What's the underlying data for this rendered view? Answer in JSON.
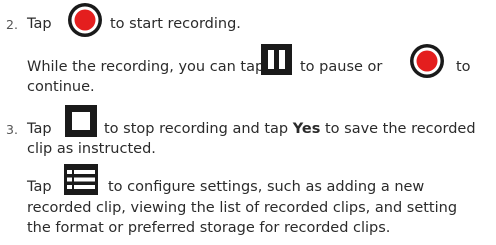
{
  "steps": [
    {
      "number": "2.",
      "line1": {
        "before": "Tap",
        "after": "to start recording.",
        "icon": "record-icon"
      },
      "line2": {
        "before": "While the recording, you can tap",
        "middle": "to pause or",
        "after": "to",
        "icon1": "pause-icon",
        "icon2": "record-icon"
      },
      "line3": "continue."
    },
    {
      "number": "3.",
      "line1": {
        "before": "Tap",
        "after_a": "to stop recording and tap",
        "bold": "Yes",
        "after_b": "to save the recorded",
        "icon": "stop-icon"
      },
      "line2": "clip as instructed.",
      "line3": {
        "before": "Tap",
        "after": "to configure settings, such as adding a new",
        "icon": "menu-icon"
      },
      "line4": "recorded clip, viewing the list of recorded clips, and setting",
      "line5": "the format or preferred storage for recorded clips."
    }
  ],
  "colors": {
    "record_red": "#e41e1e",
    "icon_dark": "#1a1a1a",
    "text": "#2b2b2b"
  }
}
